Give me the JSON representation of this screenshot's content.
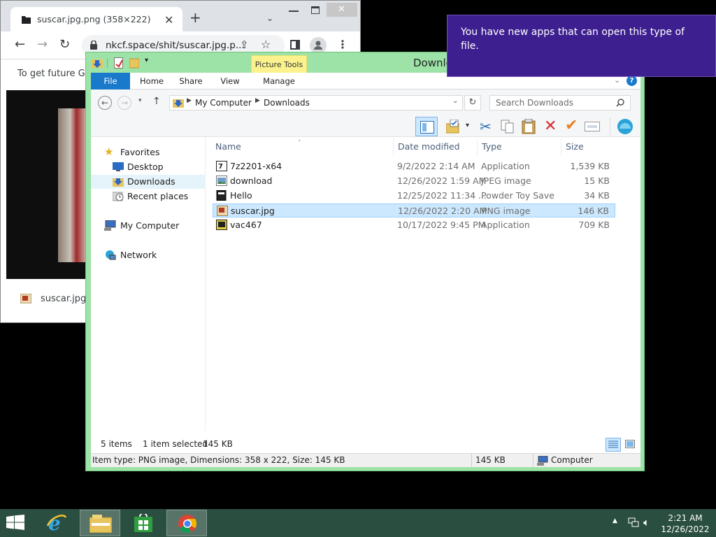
{
  "chrome": {
    "tab_title": "suscar.jpg.png (358×222)",
    "url": "nkcf.space/shit/suscar.jpg.p...",
    "infobar_text": "To get future Goo",
    "download_name": "suscar.jpg.p"
  },
  "toast": {
    "message": "You have new apps that can open this type of file."
  },
  "explorer": {
    "title": "Downlo",
    "ribbon": {
      "context_tab": "Picture Tools",
      "tabs": [
        "File",
        "Home",
        "Share",
        "View",
        "Manage"
      ]
    },
    "address": {
      "crumbs": [
        "My Computer",
        "Downloads"
      ]
    },
    "search_placeholder": "Search Downloads",
    "nav": {
      "favorites": "Favorites",
      "desktop": "Desktop",
      "downloads": "Downloads",
      "recent": "Recent places",
      "computer": "My Computer",
      "network": "Network"
    },
    "columns": {
      "name": "Name",
      "date": "Date modified",
      "type": "Type",
      "size": "Size"
    },
    "files": [
      {
        "name": "7z2201-x64",
        "date": "9/2/2022 2:14 AM",
        "type": "Application",
        "size": "1,539 KB",
        "icon": "7zip-icon"
      },
      {
        "name": "download",
        "date": "12/26/2022 1:59 AM",
        "type": "JPEG image",
        "size": "15 KB",
        "icon": "image-icon"
      },
      {
        "name": "Hello",
        "date": "12/25/2022 11:34 ...",
        "type": "Powder Toy Save",
        "size": "34 KB",
        "icon": "powder-toy-icon"
      },
      {
        "name": "suscar.jpg",
        "date": "12/26/2022 2:20 AM",
        "type": "PNG image",
        "size": "146 KB",
        "icon": "png-image-icon"
      },
      {
        "name": "vac467",
        "date": "10/17/2022 9:45 PM",
        "type": "Application",
        "size": "709 KB",
        "icon": "app-icon"
      }
    ],
    "status": {
      "items": "5 items",
      "selected": "1 item selected",
      "selected_size": "145 KB"
    },
    "details": {
      "info": "Item type: PNG image, Dimensions: 358 x 222, Size: 145 KB",
      "size": "145 KB",
      "location": "Computer"
    }
  },
  "taskbar": {
    "time": "2:21 AM",
    "date": "12/26/2022"
  }
}
